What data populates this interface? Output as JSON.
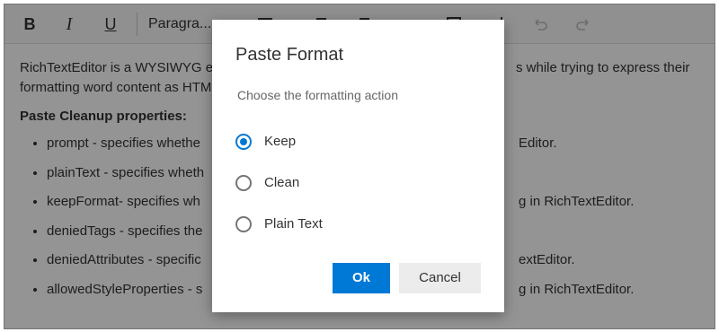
{
  "toolbar": {
    "bold": "B",
    "italic": "I",
    "underline": "U",
    "format_label": "Paragra..."
  },
  "content": {
    "intro_line1": "RichTextEditor is a WYSIWYG edi",
    "intro_line1_right": "s while trying to express their",
    "intro_line2": "formatting word content as HTM",
    "heading": "Paste Cleanup properties:",
    "items": [
      {
        "left": "prompt - specifies whethe",
        "right": "Editor."
      },
      {
        "left": "plainText - specifies wheth",
        "right": ""
      },
      {
        "left": "keepFormat- specifies wh",
        "right": "g in RichTextEditor."
      },
      {
        "left": "deniedTags - specifies the",
        "right": ""
      },
      {
        "left": "deniedAttributes - specific",
        "right": "extEditor."
      },
      {
        "left": "allowedStyleProperties - s",
        "right": "g in RichTextEditor."
      }
    ]
  },
  "dialog": {
    "title": "Paste Format",
    "subtitle": "Choose the formatting action",
    "options": [
      {
        "label": "Keep",
        "checked": true
      },
      {
        "label": "Clean",
        "checked": false
      },
      {
        "label": "Plain Text",
        "checked": false
      }
    ],
    "ok_label": "Ok",
    "cancel_label": "Cancel"
  },
  "colors": {
    "primary": "#0078d6",
    "overlay": "rgba(0,0,0,0.42)",
    "text": "#333333"
  }
}
